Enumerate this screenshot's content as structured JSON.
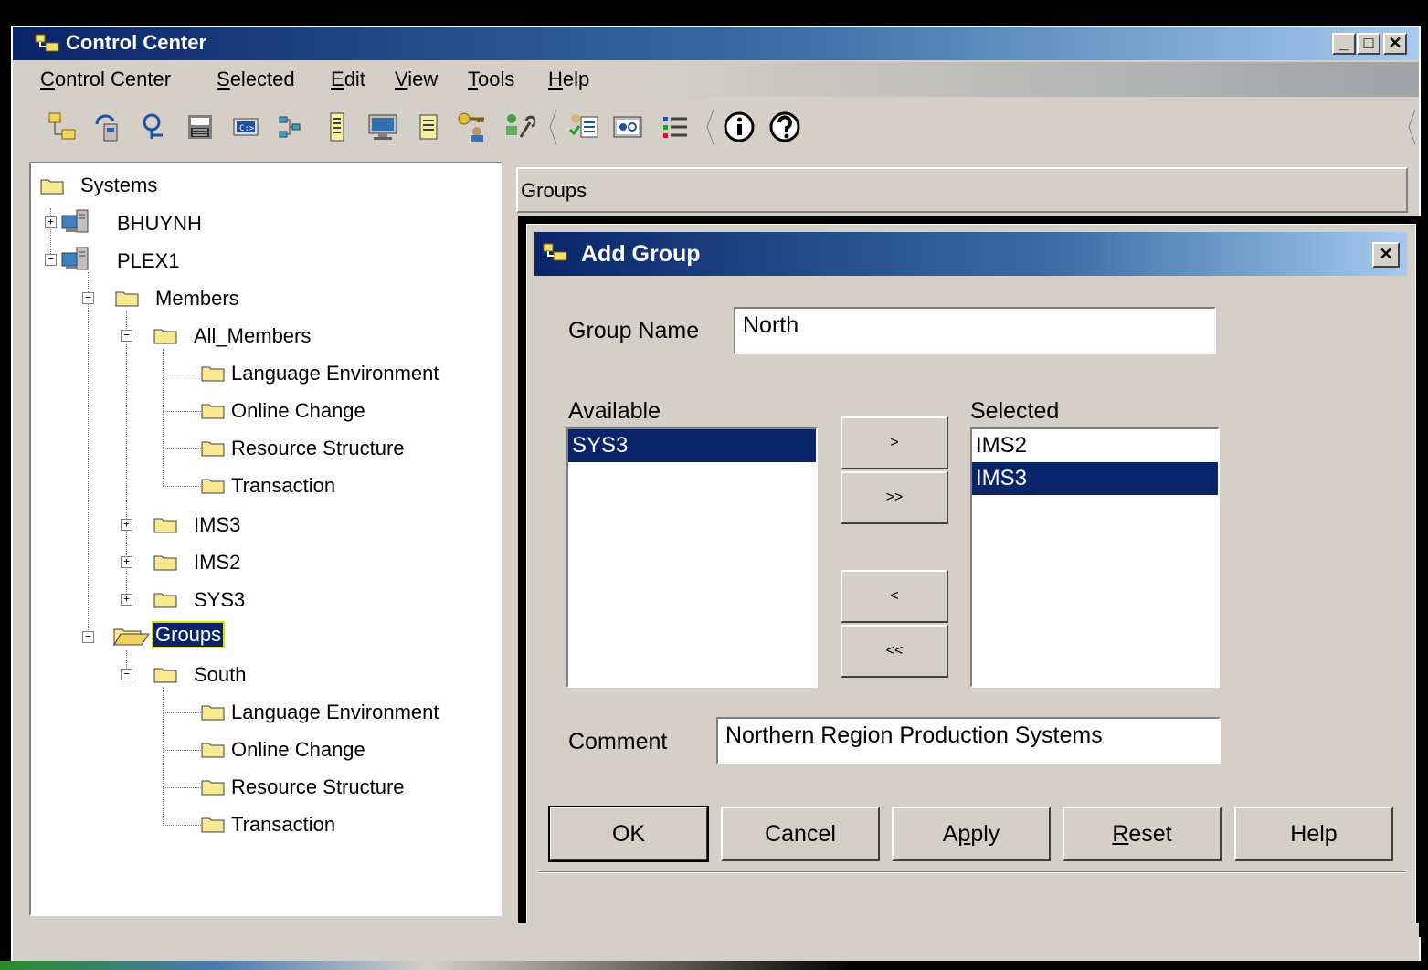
{
  "window": {
    "title": "Control Center"
  },
  "menubar": {
    "items": [
      {
        "label": "Control Center",
        "mnemonic": "C"
      },
      {
        "label": "Selected",
        "mnemonic": "S"
      },
      {
        "label": "Edit",
        "mnemonic": "E"
      },
      {
        "label": "View",
        "mnemonic": "V"
      },
      {
        "label": "Tools",
        "mnemonic": "T"
      },
      {
        "label": "Help",
        "mnemonic": "H"
      }
    ]
  },
  "toolbar": {
    "icons": [
      "object-tree-icon",
      "replication-icon",
      "search-icon",
      "command-center-icon",
      "command-window-icon",
      "network-icon",
      "journal-icon",
      "monitor-icon",
      "notes-icon",
      "key-users-icon",
      "tools-icon",
      "task-center-icon",
      "dashboard-icon",
      "list-icon",
      "info-icon",
      "help-icon"
    ]
  },
  "tree": {
    "root": "Systems",
    "bhuynh": "BHUYNH",
    "plex1": "PLEX1",
    "members": "Members",
    "all_members": "All_Members",
    "am_children": [
      "Language Environment",
      "Online Change",
      "Resource Structure",
      "Transaction"
    ],
    "ims3": "IMS3",
    "ims2": "IMS2",
    "sys3": "SYS3",
    "groups": "Groups",
    "south": "South",
    "south_children": [
      "Language Environment",
      "Online Change",
      "Resource Structure",
      "Transaction"
    ]
  },
  "right_pane": {
    "header": "Groups"
  },
  "dialog": {
    "title": "Add Group",
    "group_name_label": "Group Name",
    "group_name_value": "North",
    "available_label": "Available",
    "available_items": [
      "SYS3"
    ],
    "selected_label": "Selected",
    "selected_items": [
      "IMS2",
      "IMS3"
    ],
    "move_right": ">",
    "move_all_right": ">>",
    "move_left": "<",
    "move_all_left": "<<",
    "comment_label": "Comment",
    "comment_value": "Northern Region Production Systems",
    "buttons": {
      "ok": "OK",
      "cancel": "Cancel",
      "apply": "Apply",
      "reset": "Reset",
      "help": "Help"
    }
  },
  "colors": {
    "title_active": "#0a246a",
    "selection": "#0a246a",
    "face": "#d4d0c8"
  }
}
